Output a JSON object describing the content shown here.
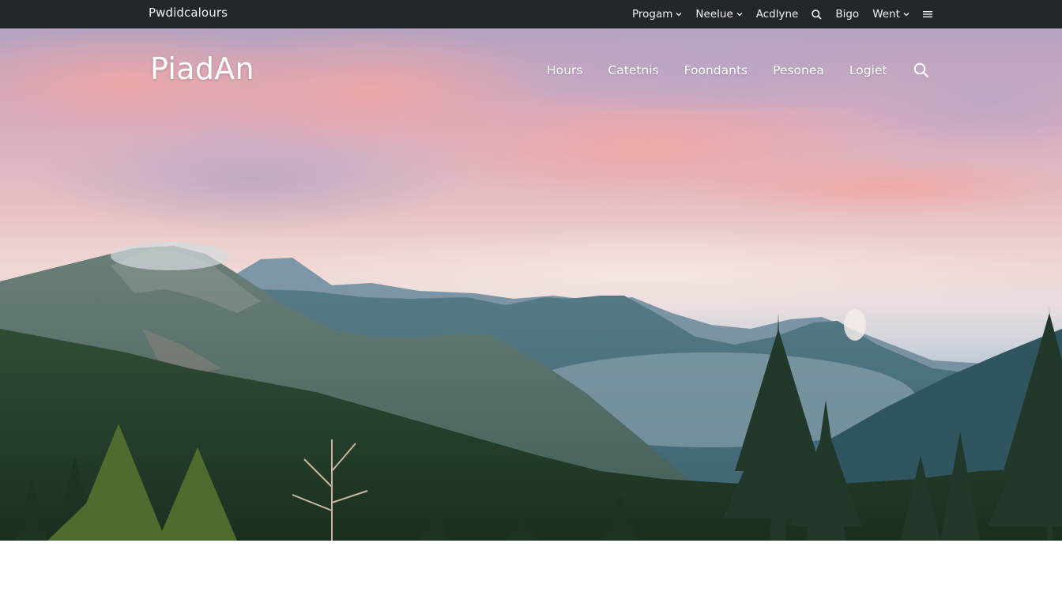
{
  "topbar": {
    "brand": "Pwdidcalours",
    "items": [
      {
        "label": "Progam",
        "dropdown": true
      },
      {
        "label": "Neelue",
        "dropdown": true
      },
      {
        "label": "Acdlyne",
        "dropdown": false
      },
      {
        "label": "Bigo",
        "dropdown": false
      },
      {
        "label": "Went",
        "dropdown": true
      }
    ],
    "icons": [
      "search-icon",
      "menu-icon",
      "chevron-down-icon"
    ]
  },
  "hero": {
    "logo": "PiadAn",
    "nav": [
      "Hours",
      "Catetnis",
      "Foondants",
      "Pesonea",
      "Logiet"
    ],
    "search_icon": "search-icon"
  },
  "colors": {
    "topbar_bg": "#22272b",
    "topbar_text": "#f2f2f2",
    "hero_text": "#ffffff",
    "page_bg": "#ffffff"
  }
}
